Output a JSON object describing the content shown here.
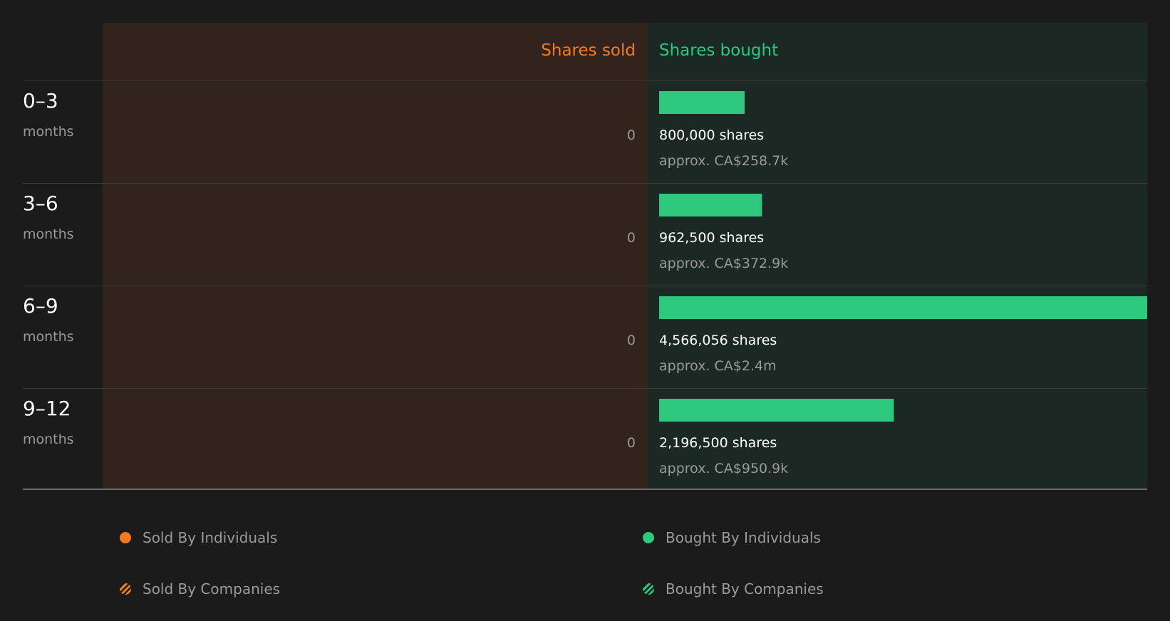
{
  "chart_data": {
    "type": "bar",
    "orientation": "horizontal-diverging",
    "headers": {
      "sold": "Shares sold",
      "bought": "Shares bought"
    },
    "row_unit": "months",
    "categories": [
      "0–3",
      "3–6",
      "6–9",
      "9–12"
    ],
    "series": [
      {
        "name": "Shares sold",
        "values": [
          0,
          0,
          0,
          0
        ],
        "labels": [
          "0",
          "0",
          "0",
          "0"
        ]
      },
      {
        "name": "Shares bought",
        "values": [
          800000,
          962500,
          4566056,
          2196500
        ],
        "labels": [
          "800,000 shares",
          "962,500 shares",
          "4,566,056 shares",
          "2,196,500 shares"
        ],
        "value_labels": [
          "approx. CA$258.7k",
          "approx. CA$372.9k",
          "approx. CA$2.4m",
          "approx. CA$950.9k"
        ]
      }
    ],
    "xlim": [
      0,
      4566056
    ],
    "legend": {
      "position": "bottom",
      "entries": [
        {
          "label": "Sold By Individuals",
          "style": "solid",
          "color": "#f47b20"
        },
        {
          "label": "Bought By Individuals",
          "style": "solid",
          "color": "#2ec77e"
        },
        {
          "label": "Sold By Companies",
          "style": "hatched",
          "color": "#f47b20"
        },
        {
          "label": "Bought By Companies",
          "style": "hatched",
          "color": "#2ec77e"
        }
      ]
    }
  },
  "colors": {
    "background": "#1b1b1b",
    "sold_panel": "#32231d",
    "bought_panel": "#1c2823",
    "sold_accent": "#f47b20",
    "bought_accent": "#2ec77e",
    "primary_text": "#ffffff",
    "muted_text": "#9a9a9a",
    "separator": "#3b3b3b",
    "baseline": "#8a8a8a"
  }
}
